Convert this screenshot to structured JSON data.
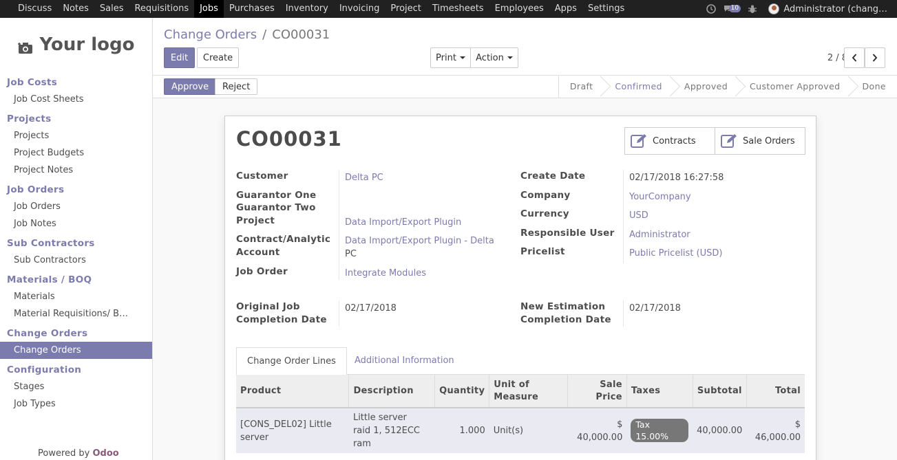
{
  "topbar": {
    "menu": [
      "Discuss",
      "Notes",
      "Sales",
      "Requisitions",
      "Jobs",
      "Purchases",
      "Inventory",
      "Invoicing",
      "Project",
      "Timesheets",
      "Employees",
      "Apps",
      "Settings"
    ],
    "active_menu": "Jobs",
    "messages_count": "10",
    "user": "Administrator (chang…"
  },
  "sidebar": {
    "logo_text": "Your logo",
    "sections": [
      {
        "title": "Job Costs",
        "items": [
          "Job Cost Sheets"
        ]
      },
      {
        "title": "Projects",
        "items": [
          "Projects",
          "Project Budgets",
          "Project Notes"
        ]
      },
      {
        "title": "Job Orders",
        "items": [
          "Job Orders",
          "Job Notes"
        ]
      },
      {
        "title": "Sub Contractors",
        "items": [
          "Sub Contractors"
        ]
      },
      {
        "title": "Materials / BOQ",
        "items": [
          "Materials",
          "Material Requisitions/ B…"
        ]
      },
      {
        "title": "Change Orders",
        "items": [
          "Change Orders"
        ]
      },
      {
        "title": "Configuration",
        "items": [
          "Stages",
          "Job Types"
        ]
      }
    ],
    "active_item": "Change Orders",
    "powered_prefix": "Powered by",
    "powered_brand": "Odoo"
  },
  "control": {
    "breadcrumb_parent": "Change Orders",
    "breadcrumb_sep": "/",
    "breadcrumb_current": "CO00031",
    "edit": "Edit",
    "create": "Create",
    "print": "Print",
    "action": "Action",
    "pager": "2 / 8"
  },
  "statusbar": {
    "approve": "Approve",
    "reject": "Reject",
    "stages": [
      "Draft",
      "Confirmed",
      "Approved",
      "Customer Approved",
      "Done"
    ],
    "current_stage": "Confirmed"
  },
  "record": {
    "title": "CO00031",
    "smart_buttons": [
      "Contracts",
      "Sale Orders"
    ],
    "left_fields": {
      "customer_label": "Customer",
      "customer": "Delta PC",
      "g1_label": "Guarantor One",
      "g2_label": "Guarantor Two",
      "project_label": "Project",
      "project": "Data Import/Export Plugin",
      "contract_label_1": "Contract/Analytic",
      "contract_label_2": "Account",
      "contract_1": "Data Import/Export Plugin - Delta",
      "contract_2": "PC",
      "job_order_label": "Job Order",
      "job_order": "Integrate Modules",
      "orig_label_1": "Original Job",
      "orig_label_2": "Completion Date",
      "orig_date": "02/17/2018"
    },
    "right_fields": {
      "create_date_label": "Create Date",
      "create_date": "02/17/2018 16:27:58",
      "company_label": "Company",
      "company": "YourCompany",
      "currency_label": "Currency",
      "currency": "USD",
      "resp_label": "Responsible User",
      "resp": "Administrator",
      "pricelist_label": "Pricelist",
      "pricelist": "Public Pricelist (USD)",
      "new_est_label_1": "New Estimation",
      "new_est_label_2": "Completion Date",
      "new_est_date": "02/17/2018"
    },
    "tabs": [
      "Change Order Lines",
      "Additional Information"
    ],
    "columns": {
      "product": "Product",
      "description": "Description",
      "quantity": "Quantity",
      "uom_1": "Unit of",
      "uom_2": "Measure",
      "sale_price": "Sale Price",
      "taxes": "Taxes",
      "subtotal": "Subtotal",
      "total": "Total"
    },
    "line": {
      "product_1": "[CONS_DEL02] Little",
      "product_2": "server",
      "desc_1": "Little server",
      "desc_2": "raid 1, 512ECC",
      "desc_3": "ram",
      "quantity": "1.000",
      "uom": "Unit(s)",
      "sale_price": "$ 40,000.00",
      "tax": "Tax 15.00%",
      "subtotal": "40,000.00",
      "total": "$ 46,000.00"
    }
  },
  "colors": {
    "accent": "#7c7bad",
    "topbar": "#212121",
    "brand": "#875a7b"
  }
}
